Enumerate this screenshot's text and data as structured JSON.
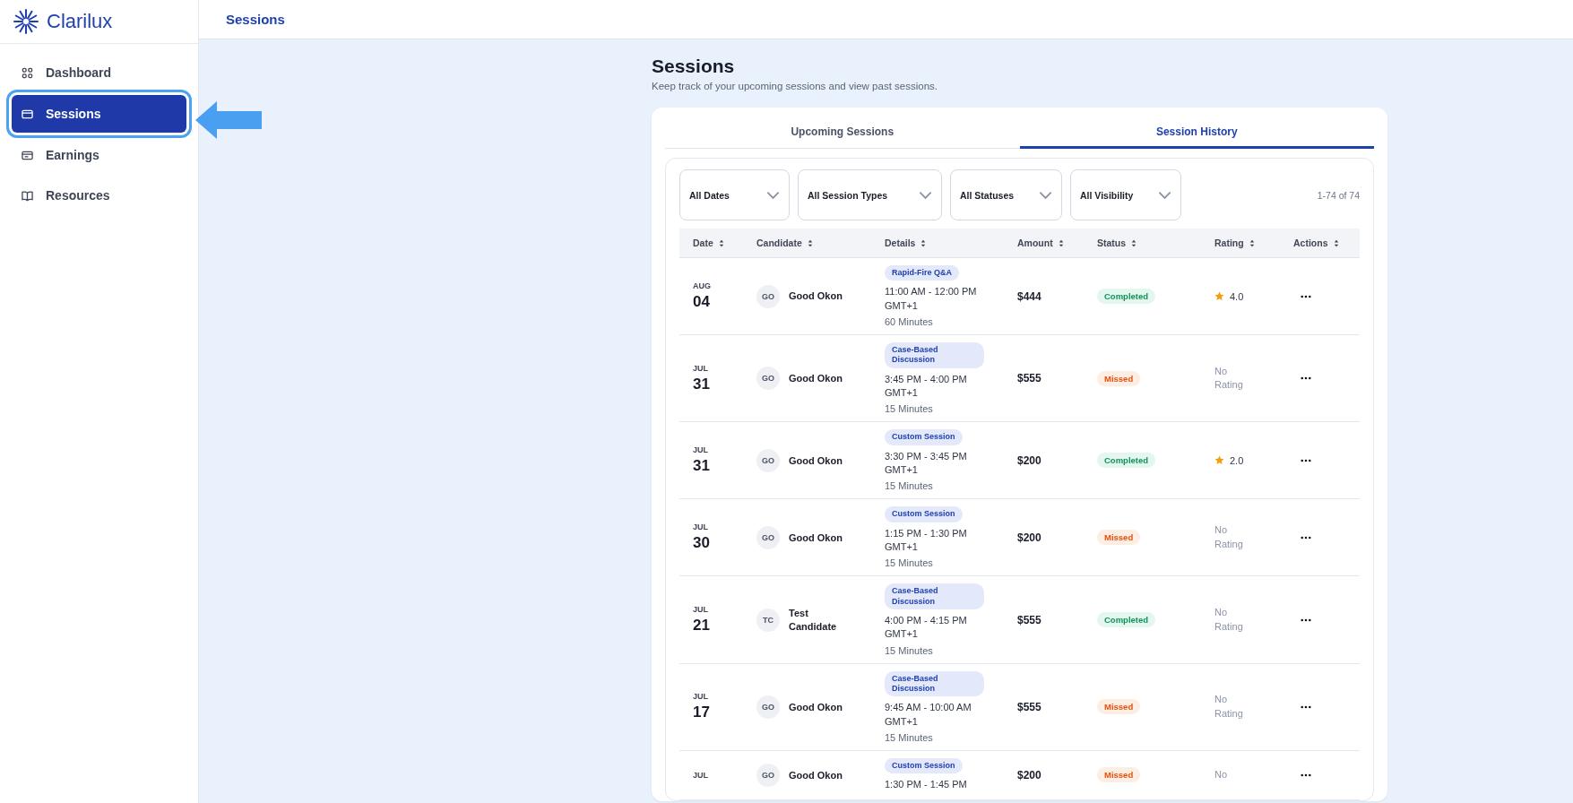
{
  "brand": {
    "name": "Clarilux"
  },
  "header": {
    "title": "Sessions"
  },
  "sidebar": {
    "items": [
      {
        "label": "Dashboard",
        "selected": false
      },
      {
        "label": "Sessions",
        "selected": true
      },
      {
        "label": "Earnings",
        "selected": false
      },
      {
        "label": "Resources",
        "selected": false
      }
    ]
  },
  "page": {
    "title": "Sessions",
    "subtitle": "Keep track of your upcoming sessions and view past sessions."
  },
  "tabs": [
    {
      "label": "Upcoming Sessions",
      "selected": false
    },
    {
      "label": "Session History",
      "selected": true
    }
  ],
  "filters": [
    {
      "label": "All Dates"
    },
    {
      "label": "All Session Types"
    },
    {
      "label": "All Statuses"
    },
    {
      "label": "All Visibility"
    }
  ],
  "count": "1-74 of 74",
  "table": {
    "columns": [
      "Date",
      "Candidate",
      "Details",
      "Amount",
      "Status",
      "Rating",
      "Actions"
    ],
    "rows": [
      {
        "month": "AUG",
        "day": "04",
        "initials": "GO",
        "candidate": "Good Okon",
        "session_type": "Rapid-Fire Q&A",
        "time": "11:00 AM - 12:00 PM",
        "timezone": "GMT+1",
        "duration": "60 Minutes",
        "amount": "$444",
        "status": {
          "label": "Completed",
          "kind": "completed"
        },
        "rating": {
          "kind": "score",
          "text": "4.0"
        }
      },
      {
        "month": "JUL",
        "day": "31",
        "initials": "GO",
        "candidate": "Good Okon",
        "session_type": "Case-Based Discussion",
        "time": "3:45 PM - 4:00 PM",
        "timezone": "GMT+1",
        "duration": "15 Minutes",
        "amount": "$555",
        "status": {
          "label": "Missed",
          "kind": "missed"
        },
        "rating": {
          "kind": "none",
          "text": "No Rating"
        }
      },
      {
        "month": "JUL",
        "day": "31",
        "initials": "GO",
        "candidate": "Good Okon",
        "session_type": "Custom Session",
        "time": "3:30 PM - 3:45 PM",
        "timezone": "GMT+1",
        "duration": "15 Minutes",
        "amount": "$200",
        "status": {
          "label": "Completed",
          "kind": "completed"
        },
        "rating": {
          "kind": "score",
          "text": "2.0"
        }
      },
      {
        "month": "JUL",
        "day": "30",
        "initials": "GO",
        "candidate": "Good Okon",
        "session_type": "Custom Session",
        "time": "1:15 PM - 1:30 PM",
        "timezone": "GMT+1",
        "duration": "15 Minutes",
        "amount": "$200",
        "status": {
          "label": "Missed",
          "kind": "missed"
        },
        "rating": {
          "kind": "none",
          "text": "No Rating"
        }
      },
      {
        "month": "JUL",
        "day": "21",
        "initials": "TC",
        "candidate": "Test Candidate",
        "session_type": "Case-Based Discussion",
        "time": "4:00 PM - 4:15 PM",
        "timezone": "GMT+1",
        "duration": "15 Minutes",
        "amount": "$555",
        "status": {
          "label": "Completed",
          "kind": "completed"
        },
        "rating": {
          "kind": "none",
          "text": "No Rating"
        }
      },
      {
        "month": "JUL",
        "day": "17",
        "initials": "GO",
        "candidate": "Good Okon",
        "session_type": "Case-Based Discussion",
        "time": "9:45 AM - 10:00 AM",
        "timezone": "GMT+1",
        "duration": "15 Minutes",
        "amount": "$555",
        "status": {
          "label": "Missed",
          "kind": "missed"
        },
        "rating": {
          "kind": "none",
          "text": "No Rating"
        }
      },
      {
        "month": "JUL",
        "initials": "GO",
        "candidate": "Good Okon",
        "session_type": "Custom Session",
        "time": "1:30 PM - 1:45 PM",
        "amount": "$200",
        "status": {
          "label": "Missed",
          "kind": "missed"
        },
        "rating": {
          "kind": "none",
          "text": "No"
        }
      }
    ]
  }
}
